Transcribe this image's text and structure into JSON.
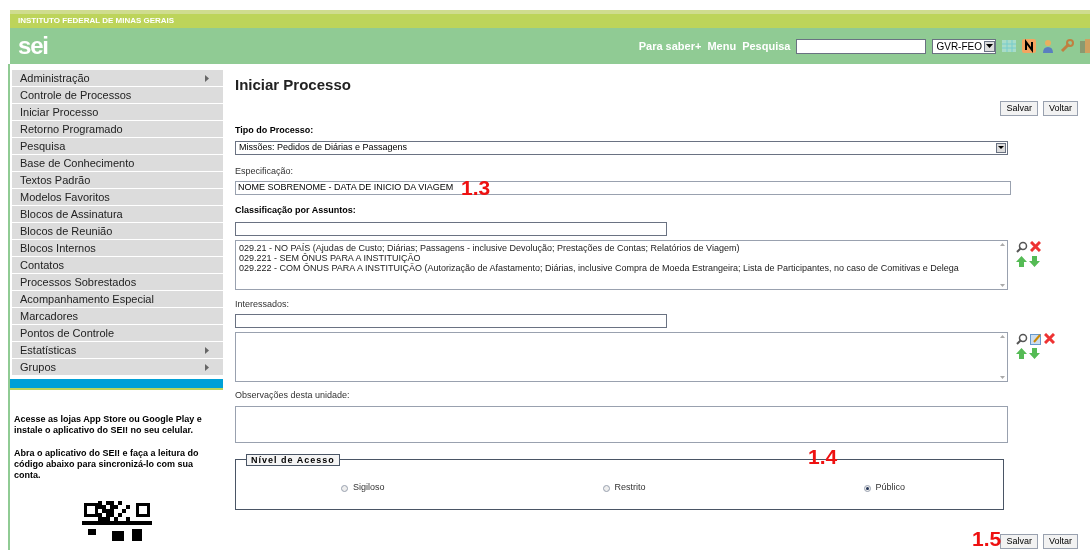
{
  "header": {
    "institution": "INSTITUTO FEDERAL DE MINAS GERAIS",
    "logo": "sei",
    "links": [
      "Para saber+",
      "Menu",
      "Pesquisa"
    ],
    "unit_select": "GVR-FEO"
  },
  "sidebar": {
    "items": [
      {
        "label": "Administração",
        "has_submenu": true
      },
      {
        "label": "Controle de Processos",
        "has_submenu": false
      },
      {
        "label": "Iniciar Processo",
        "has_submenu": false
      },
      {
        "label": "Retorno Programado",
        "has_submenu": false
      },
      {
        "label": "Pesquisa",
        "has_submenu": false
      },
      {
        "label": "Base de Conhecimento",
        "has_submenu": false
      },
      {
        "label": "Textos Padrão",
        "has_submenu": false
      },
      {
        "label": "Modelos Favoritos",
        "has_submenu": false
      },
      {
        "label": "Blocos de Assinatura",
        "has_submenu": false
      },
      {
        "label": "Blocos de Reunião",
        "has_submenu": false
      },
      {
        "label": "Blocos Internos",
        "has_submenu": false
      },
      {
        "label": "Contatos",
        "has_submenu": false
      },
      {
        "label": "Processos Sobrestados",
        "has_submenu": false
      },
      {
        "label": "Acompanhamento Especial",
        "has_submenu": false
      },
      {
        "label": "Marcadores",
        "has_submenu": false
      },
      {
        "label": "Pontos de Controle",
        "has_submenu": false
      },
      {
        "label": "Estatísticas",
        "has_submenu": true
      },
      {
        "label": "Grupos",
        "has_submenu": true
      }
    ],
    "app_notes": [
      "Acesse as lojas App Store ou Google Play e instale o aplicativo do SEI! no seu celular.",
      "Abra o aplicativo do SEI! e faça a leitura do código abaixo para sincronizá-lo com sua conta."
    ]
  },
  "form": {
    "title": "Iniciar Processo",
    "buttons": [
      "Salvar",
      "Voltar"
    ],
    "tipo_label": "Tipo do Processo:",
    "tipo_value": "Missões: Pedidos de Diárias e Passagens",
    "especificacao_label": "Especificação:",
    "especificacao_value": "NOME SOBRENOME - DATA DE INICIO DA VIAGEM",
    "assuntos_label": "Classificação por Assuntos:",
    "assuntos": [
      "029.21 - NO PAÍS (Ajudas de Custo; Diárias; Passagens - inclusive Devolução; Prestações de Contas; Relatórios de Viagem)",
      "029.221 - SEM ÔNUS PARA A INSTITUIÇÃO",
      "029.222 - COM ÔNUS PARA A INSTITUIÇÃO (Autorização de Afastamento; Diárias, inclusive Compra de Moeda Estrangeira; Lista de Participantes, no caso de Comitivas e Delega"
    ],
    "interessados_label": "Interessados:",
    "observacoes_label": "Observações desta unidade:",
    "nivel_label": "Nível de Acesso",
    "nivel_options": [
      {
        "label": "Sigiloso",
        "selected": false
      },
      {
        "label": "Restrito",
        "selected": false
      },
      {
        "label": "Público",
        "selected": true
      }
    ],
    "bottom_buttons": [
      "Salvar",
      "Voltar"
    ]
  },
  "annotations": [
    "1.3",
    "1.4",
    "1.5"
  ]
}
